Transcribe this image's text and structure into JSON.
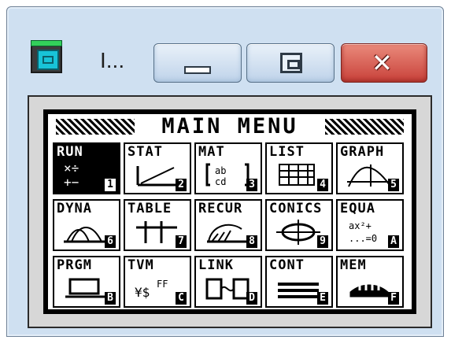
{
  "window": {
    "title": "I...",
    "buttons": {
      "minimize": "minimize",
      "maximize": "maximize",
      "close": "close"
    }
  },
  "screen": {
    "title": "MAIN MENU",
    "tiles": [
      {
        "label": "RUN",
        "key": "1",
        "icon": "run-icon"
      },
      {
        "label": "STAT",
        "key": "2",
        "icon": "stat-icon"
      },
      {
        "label": "MAT",
        "key": "3",
        "icon": "matrix-icon"
      },
      {
        "label": "LIST",
        "key": "4",
        "icon": "list-icon"
      },
      {
        "label": "GRAPH",
        "key": "5",
        "icon": "graph-icon"
      },
      {
        "label": "DYNA",
        "key": "6",
        "icon": "dyna-icon"
      },
      {
        "label": "TABLE",
        "key": "7",
        "icon": "table-icon"
      },
      {
        "label": "RECUR",
        "key": "8",
        "icon": "recur-icon"
      },
      {
        "label": "CONICS",
        "key": "9",
        "icon": "conics-icon"
      },
      {
        "label": "EQUA",
        "key": "A",
        "icon": "equa-icon"
      },
      {
        "label": "PRGM",
        "key": "B",
        "icon": "prgm-icon"
      },
      {
        "label": "TVM",
        "key": "C",
        "icon": "tvm-icon"
      },
      {
        "label": "LINK",
        "key": "D",
        "icon": "link-icon"
      },
      {
        "label": "CONT",
        "key": "E",
        "icon": "contrast-icon"
      },
      {
        "label": "MEM",
        "key": "F",
        "icon": "memory-icon"
      }
    ]
  }
}
